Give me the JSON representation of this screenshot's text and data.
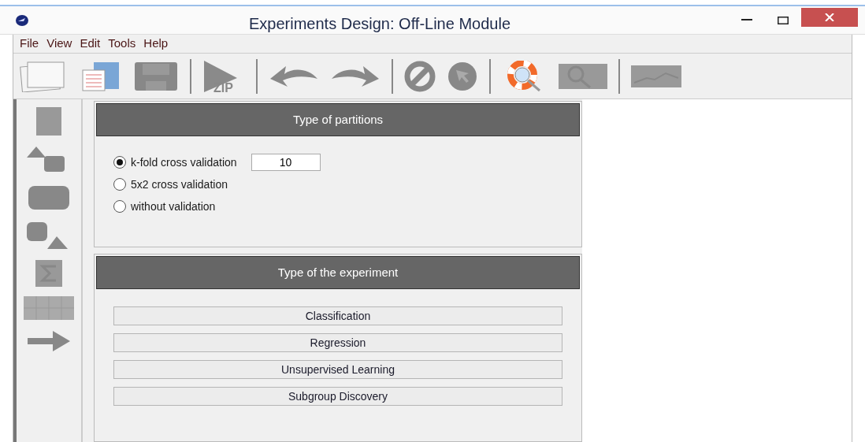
{
  "window": {
    "title": "Experiments Design: Off-Line Module"
  },
  "menu": [
    "File",
    "View",
    "Edit",
    "Tools",
    "Help"
  ],
  "toolbar": {
    "zip_label": "ZIP"
  },
  "partitions": {
    "title": "Type of partitions",
    "options": [
      {
        "label": "k-fold cross validation",
        "selected": true,
        "value": "10"
      },
      {
        "label": "5x2 cross validation",
        "selected": false
      },
      {
        "label": "without validation",
        "selected": false
      }
    ]
  },
  "experiment": {
    "title": "Type of the experiment",
    "buttons": [
      "Classification",
      "Regression",
      "Unsupervised Learning",
      "Subgroup Discovery"
    ]
  }
}
